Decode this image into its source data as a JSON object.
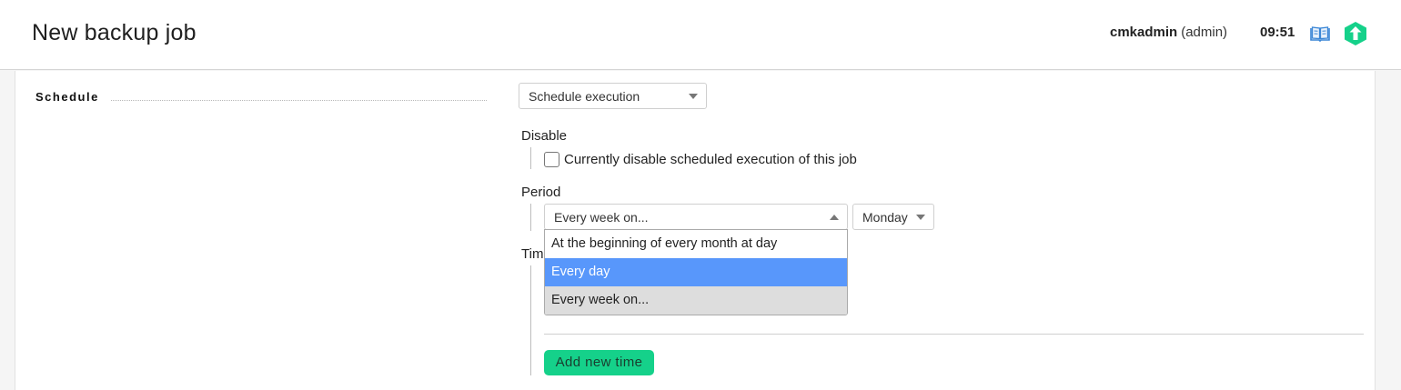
{
  "header": {
    "title": "New backup job",
    "username": "cmkadmin",
    "role": "(admin)",
    "time": "09:51",
    "icons": {
      "help": "book-icon",
      "logo": "checkmk-logo-icon"
    },
    "logo_color": "#15d18a"
  },
  "form": {
    "section_label": "Schedule",
    "schedule_select": "Schedule execution",
    "disable": {
      "label": "Disable",
      "checkbox_label": "Currently disable scheduled execution of this job",
      "checked": false
    },
    "period": {
      "label": "Period",
      "selected": "Every week on...",
      "day_selected": "Monday",
      "options": [
        "At the beginning of every month at day",
        "Every day",
        "Every week on..."
      ],
      "highlighted_option": "Every day",
      "highlight_color": "#5897fb"
    },
    "times": {
      "label_visible": "Tim",
      "add_button": "Add new time"
    }
  }
}
